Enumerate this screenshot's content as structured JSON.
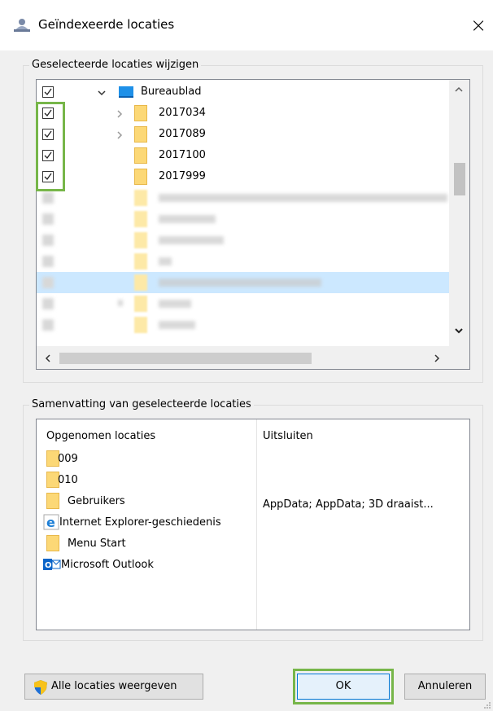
{
  "window": {
    "title": "Geïndexeerde locaties",
    "close_icon": "×"
  },
  "modify_group": {
    "label": "Geselecteerde locaties wijzigen",
    "tree": [
      {
        "label": "Bureaublad",
        "checked": true,
        "expanded": true,
        "level": 0
      },
      {
        "label": "2017034",
        "checked": true,
        "expandable": true,
        "level": 1
      },
      {
        "label": "2017089",
        "checked": true,
        "expandable": true,
        "level": 1
      },
      {
        "label": "2017100",
        "checked": true,
        "expandable": false,
        "level": 1
      },
      {
        "label": "2017999",
        "checked": true,
        "expandable": false,
        "level": 1
      }
    ]
  },
  "summary_group": {
    "label": "Samenvatting van geselecteerde locaties",
    "col_included": "Opgenomen locaties",
    "col_excluded": "Uitsluiten",
    "included": [
      {
        "label": "009",
        "icon": "folder-icon"
      },
      {
        "label": "010",
        "icon": "folder-icon"
      },
      {
        "label": "Gebruikers",
        "icon": "folder-icon"
      },
      {
        "label": "Internet Explorer-geschiedenis",
        "icon": "ie-icon"
      },
      {
        "label": "Menu Start",
        "icon": "folder-icon"
      },
      {
        "label": "Microsoft Outlook",
        "icon": "outlook-icon"
      }
    ],
    "excluded_gebruikers": "AppData; AppData; 3D draaist..."
  },
  "buttons": {
    "show_all": "Alle locaties weergeven",
    "ok": "OK",
    "cancel": "Annuleren"
  },
  "colors": {
    "highlight_green": "#77b649",
    "selection_blue": "#cce8ff",
    "folder_yellow": "#fcd876"
  }
}
